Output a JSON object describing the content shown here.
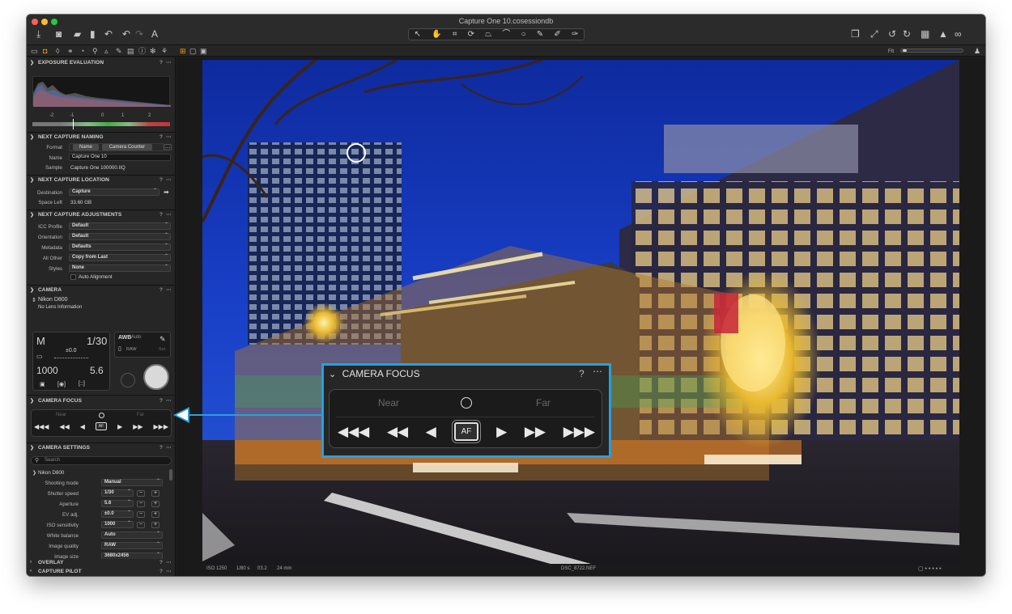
{
  "window": {
    "title": "Capture One 10.cosessiondb"
  },
  "icons": {
    "toolbar_left": [
      "import-icon",
      "camera-icon",
      "folder-icon",
      "trash-icon",
      "hand-undo-icon",
      "undo-icon",
      "redo-icon",
      "text-icon"
    ],
    "tools": [
      "cursor-icon",
      "pan-icon",
      "crop-icon",
      "rotate-icon",
      "keystone-icon",
      "spot-icon",
      "circle-icon",
      "picker-icon",
      "brush-icon",
      "eraser-icon"
    ],
    "toolbar_right": [
      "stack-icon",
      "expand-icon",
      "rotate-left-icon",
      "rotate-right-icon",
      "grid-icon",
      "warning-icon",
      "glasses-icon"
    ]
  },
  "viewer_toggle_label": "FIt",
  "exposure_evaluation": {
    "title": "EXPOSURE EVALUATION",
    "scale": [
      "-2",
      "-1",
      "0",
      "1",
      "2"
    ]
  },
  "next_capture_naming": {
    "title": "NEXT CAPTURE NAMING",
    "format_label": "Format",
    "format_tokens": [
      "Name",
      "Camera Counter"
    ],
    "name_label": "Name",
    "name_value": "Capture One 10",
    "sample_label": "Sample",
    "sample_value": "Capture One 100000.IIQ"
  },
  "next_capture_location": {
    "title": "NEXT CAPTURE LOCATION",
    "destination_label": "Destination",
    "destination_value": "Capture",
    "space_label": "Space Left",
    "space_value": "33.60 GB"
  },
  "next_capture_adjustments": {
    "title": "NEXT CAPTURE ADJUSTMENTS",
    "rows": [
      {
        "label": "ICC Profile",
        "value": "Default"
      },
      {
        "label": "Orientation",
        "value": "Default"
      },
      {
        "label": "Metadata",
        "value": "Defaults"
      },
      {
        "label": "All Other",
        "value": "Copy from Last"
      },
      {
        "label": "Styles",
        "value": "None"
      }
    ],
    "auto_alignment": "Auto Alignment"
  },
  "camera": {
    "title": "CAMERA",
    "model": "Nikon D800",
    "lens": "No Lens Information",
    "mode": "M",
    "shutter": "1/30",
    "ev": "±0.0",
    "iso": "1000",
    "aperture": "5.6",
    "wb_label": "AWB",
    "wb_value": "Auto",
    "raw_label": "RAW",
    "set_label": "Set"
  },
  "camera_focus": {
    "title": "CAMERA FOCUS",
    "near": "Near",
    "far": "Far",
    "af": "AF"
  },
  "camera_settings": {
    "title": "CAMERA SETTINGS",
    "search_placeholder": "Search",
    "group": "Nikon D800",
    "rows": [
      {
        "label": "Shooting mode",
        "value": "Manual"
      },
      {
        "label": "Shutter speed",
        "value": "1/30"
      },
      {
        "label": "Aperture",
        "value": "5.6"
      },
      {
        "label": "EV adj.",
        "value": "±0.0"
      },
      {
        "label": "ISO sensitivity",
        "value": "1000"
      },
      {
        "label": "White balance",
        "value": "Auto"
      },
      {
        "label": "Image quality",
        "value": "RAW"
      },
      {
        "label": "Image size",
        "value": "3680x2456"
      }
    ]
  },
  "overlay": {
    "title": "OVERLAY"
  },
  "capture_pilot": {
    "title": "CAPTURE PILOT"
  },
  "statusbar": {
    "iso": "ISO 1250",
    "shutter": "1/80 s",
    "aperture": "f/3.2",
    "focal": "24 mm",
    "filename": "DSC_8722.NEF"
  },
  "callout": {
    "title": "CAMERA FOCUS",
    "near": "Near",
    "far": "Far",
    "af": "AF",
    "color": "#2aa0d8"
  },
  "colors": {
    "accent": "#f29c1a",
    "callout": "#2aa0d8"
  }
}
